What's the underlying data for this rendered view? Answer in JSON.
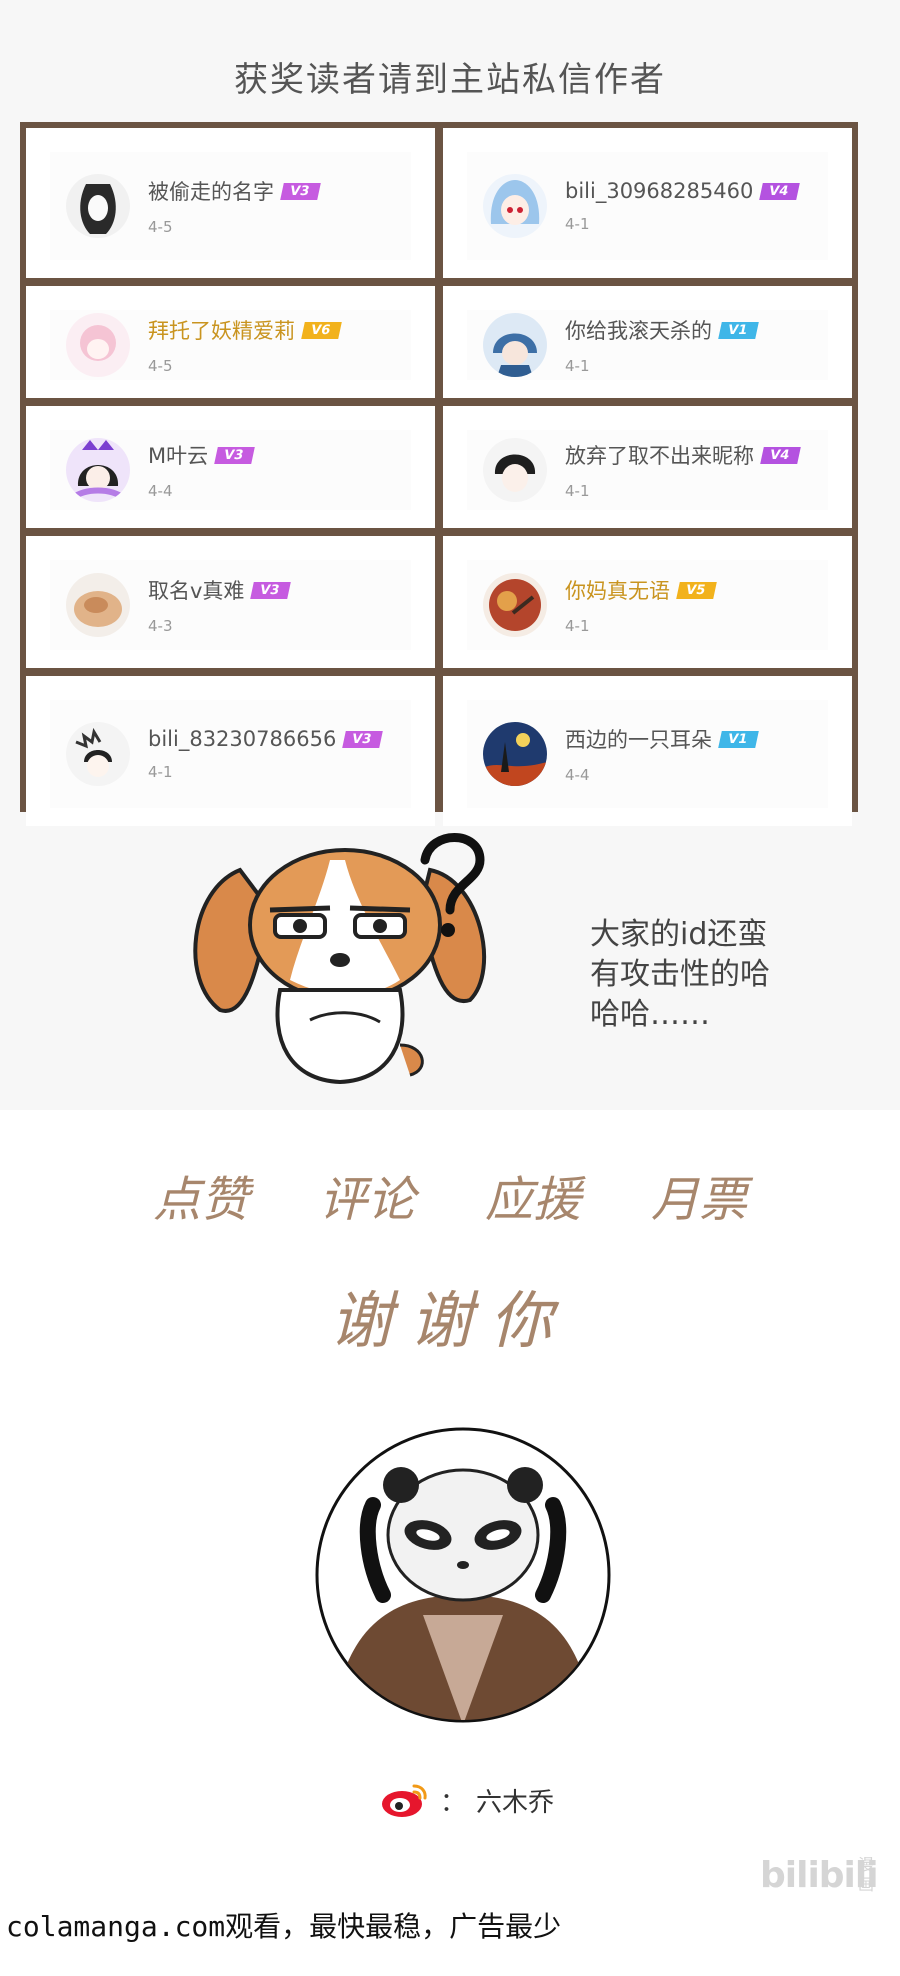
{
  "header": {
    "title": "获奖读者请到主站私信作者"
  },
  "winners": [
    {
      "name": "被偷走的名字",
      "level": "V3",
      "badge_color": "#c65be0",
      "meta": "4-5",
      "gold": false,
      "avatar": "sketch-girl"
    },
    {
      "name": "bili_30968285460",
      "level": "V4",
      "badge_color": "#b452e0",
      "meta": "4-1",
      "gold": false,
      "avatar": "blue-hair-girl"
    },
    {
      "name": "拜托了妖精爱莉",
      "level": "V6",
      "badge_color": "#f2b21c",
      "meta": "4-5",
      "gold": true,
      "avatar": "pink-fairy"
    },
    {
      "name": "你给我滚天杀的",
      "level": "V1",
      "badge_color": "#3fb6e8",
      "meta": "4-1",
      "gold": false,
      "avatar": "blue-hair-boy"
    },
    {
      "name": "M叶云",
      "level": "V3",
      "badge_color": "#c65be0",
      "meta": "4-4",
      "gold": false,
      "avatar": "crowned-girl"
    },
    {
      "name": "放弃了取不出来昵称",
      "level": "V4",
      "badge_color": "#b452e0",
      "meta": "4-1",
      "gold": false,
      "avatar": "dark-hair-boy"
    },
    {
      "name": "取名v真难",
      "level": "V3",
      "badge_color": "#c65be0",
      "meta": "4-3",
      "gold": false,
      "avatar": "food-plate"
    },
    {
      "name": "你妈真无语",
      "level": "V5",
      "badge_color": "#f2b21c",
      "meta": "4-1",
      "gold": true,
      "avatar": "red-art"
    },
    {
      "name": "bili_83230786656",
      "level": "V3",
      "badge_color": "#c65be0",
      "meta": "4-1",
      "gold": false,
      "avatar": "star-boy"
    },
    {
      "name": "西边的一只耳朵",
      "level": "V1",
      "badge_color": "#3fb6e8",
      "meta": "4-4",
      "gold": false,
      "avatar": "starry-night"
    }
  ],
  "speech": {
    "line1": "大家的id还蛮",
    "line2": "有攻击性的哈",
    "line3": "哈哈……"
  },
  "thanks": {
    "items": [
      "点赞",
      "评论",
      "应援",
      "月票"
    ],
    "closing": "谢谢你"
  },
  "author": {
    "weibo_icon": "weibo-icon",
    "separator": "：",
    "name": "六木乔"
  },
  "watermark": {
    "brand": "bilibili",
    "sub": "漫画"
  },
  "footer": {
    "text": "colamanga.com观看，最快最稳，广告最少"
  },
  "colors": {
    "frame": "#6b5443",
    "hand_text": "#a7866c"
  }
}
